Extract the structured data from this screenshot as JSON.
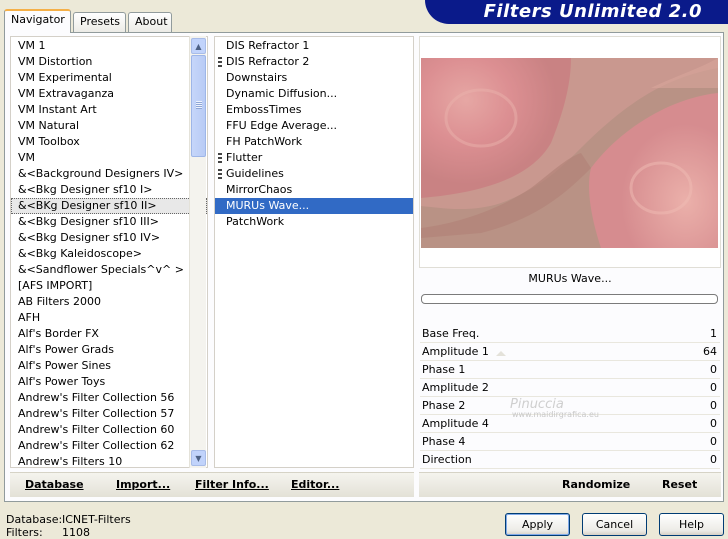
{
  "banner": {
    "title": "Filters Unlimited 2.0"
  },
  "tabs": [
    {
      "label": "Navigator",
      "active": true
    },
    {
      "label": "Presets",
      "active": false
    },
    {
      "label": "About",
      "active": false
    }
  ],
  "categories": [
    "VM 1",
    "VM Distortion",
    "VM Experimental",
    "VM Extravaganza",
    "VM Instant Art",
    "VM Natural",
    "VM Toolbox",
    "VM",
    "&<Background Designers IV>",
    "&<Bkg Designer sf10 I>",
    "&<BKg Designer sf10 II>",
    "&<Bkg Designer sf10 III>",
    "&<Bkg Designer sf10 IV>",
    "&<Bkg Kaleidoscope>",
    "&<Sandflower Specials^v^ >",
    "[AFS IMPORT]",
    "AB Filters 2000",
    "AFH",
    "Alf's Border FX",
    "Alf's Power Grads",
    "Alf's Power Sines",
    "Alf's Power Toys",
    "Andrew's Filter Collection 56",
    "Andrew's Filter Collection 57",
    "Andrew's Filter Collection 60",
    "Andrew's Filter Collection 62",
    "Andrew's Filters 10"
  ],
  "selected_category": "&<BKg Designer sf10 II>",
  "filters": [
    {
      "label": "DIS Refractor 1",
      "group": false
    },
    {
      "label": "DIS Refractor 2",
      "group": true
    },
    {
      "label": "Downstairs",
      "group": false
    },
    {
      "label": "Dynamic Diffusion...",
      "group": false
    },
    {
      "label": "EmbossTimes",
      "group": false
    },
    {
      "label": "FFU Edge Average...",
      "group": false
    },
    {
      "label": "FH PatchWork",
      "group": false
    },
    {
      "label": "Flutter",
      "group": true
    },
    {
      "label": "Guidelines",
      "group": true
    },
    {
      "label": "MirrorChaos",
      "group": false
    },
    {
      "label": "MURUs Wave...",
      "group": false
    },
    {
      "label": "PatchWork",
      "group": false
    }
  ],
  "selected_filter": "MURUs Wave...",
  "preview": {
    "filter_name": "MURUs Wave...",
    "progress": 0
  },
  "params": [
    {
      "label": "Base Freq.",
      "value": "1"
    },
    {
      "label": "Amplitude 1",
      "value": "64"
    },
    {
      "label": "Phase 1",
      "value": "0"
    },
    {
      "label": "Amplitude 2",
      "value": "0"
    },
    {
      "label": "Phase 2",
      "value": "0"
    },
    {
      "label": "Amplitude 4",
      "value": "0"
    },
    {
      "label": "Phase 4",
      "value": "0"
    },
    {
      "label": "Direction",
      "value": "0"
    }
  ],
  "watermark": {
    "text": "Pinuccia",
    "sub": "www.maidirgrafica.eu"
  },
  "strip_left": {
    "database": "Database",
    "import": "Import...",
    "filter_info": "Filter Info...",
    "editor": "Editor..."
  },
  "strip_right": {
    "randomize": "Randomize",
    "reset": "Reset"
  },
  "footer": {
    "database_label": "Database:",
    "database_value": "ICNET-Filters",
    "filters_label": "Filters:",
    "filters_value": "1108"
  },
  "buttons": {
    "apply": "Apply",
    "cancel": "Cancel",
    "help": "Help"
  },
  "colors": {
    "banner": "#0a1a8a",
    "selection": "#316ac5",
    "tab_accent": "#f5b048",
    "preview_pink": "#d98a8c"
  }
}
